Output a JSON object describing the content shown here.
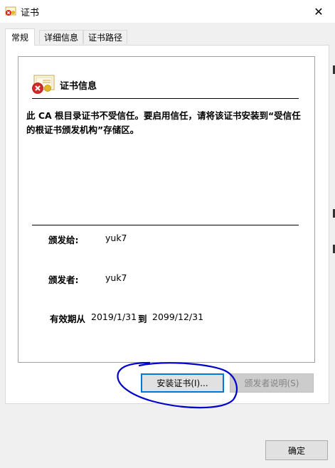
{
  "window": {
    "title": "证书",
    "icon": "certificate-warning-icon",
    "close_glyph": "✕"
  },
  "tabs": [
    {
      "label": "常规",
      "active": true
    },
    {
      "label": "详细信息",
      "active": false
    },
    {
      "label": "证书路径",
      "active": false
    }
  ],
  "general": {
    "section_title": "证书信息",
    "message": "此 CA 根目录证书不受信任。要启用信任，请将该证书安装到“受信任的根证书颁发机构”存储区。",
    "issued_to_label": "颁发给:",
    "issued_to_value": "yuk7",
    "issued_by_label": "颁发者:",
    "issued_by_value": "yuk7",
    "validity_label": "有效期从",
    "valid_from": "2019/1/31",
    "to_label": "到",
    "valid_to": "2099/12/31"
  },
  "buttons": {
    "install": "安装证书(I)...",
    "issuer_statement": "颁发者说明(S)",
    "ok": "确定"
  },
  "colors": {
    "focus_border": "#0078d7",
    "annotation_ink": "#0000cc"
  }
}
